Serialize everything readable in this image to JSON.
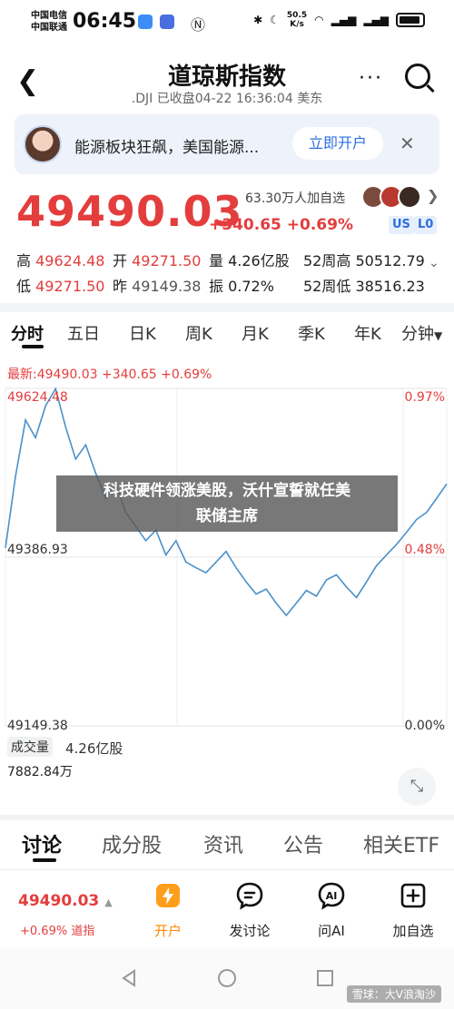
{
  "status_bar": {
    "carrier1": "中国电信",
    "carrier2": "中国联通",
    "time": "06:45",
    "net_speed_value": "50.5",
    "net_speed_unit": "K/s",
    "battery": "100"
  },
  "header": {
    "title": "道琼斯指数",
    "subtitle": ".DJI 已收盘04-22 16:36:04 美东"
  },
  "banner": {
    "text": "能源板块狂飙，美国能源...",
    "button": "立即开户",
    "close": "✕"
  },
  "quote": {
    "price": "49490.03",
    "change": "+340.65 +0.69%",
    "watchers": "63.30万人加自选",
    "tag_us": "US",
    "tag_l0": "L0"
  },
  "stats": {
    "high_label": "高",
    "high": "49624.48",
    "open_label": "开",
    "open": "49271.50",
    "volume_label": "量",
    "volume": "4.26亿股",
    "w52high_label": "52周高",
    "w52high": "50512.79",
    "low_label": "低",
    "low": "49271.50",
    "prev_label": "昨",
    "prev": "49149.38",
    "amp_label": "振",
    "amp": "0.72%",
    "w52low_label": "52周低",
    "w52low": "38516.23"
  },
  "chart_tabs": [
    "分时",
    "五日",
    "日K",
    "周K",
    "月K",
    "季K",
    "年K",
    "分钟"
  ],
  "chart": {
    "latest_label": "最新:49490.03 +340.65 +0.69%",
    "y_top": "49624.48",
    "y_mid": "49386.93",
    "y_bottom": "49149.38",
    "pct_top": "0.97%",
    "pct_mid": "0.48%",
    "pct_bottom": "0.00%",
    "line_color": "#4a90c8"
  },
  "chart_data": {
    "type": "line",
    "title": "",
    "xlabel": "",
    "ylabel": "",
    "ylim": [
      49149.38,
      49624.48
    ],
    "series": [
      {
        "values": [
          49400,
          49500,
          49580,
          49555,
          49600,
          49624,
          49570,
          49525,
          49545,
          49505,
          49470,
          49490,
          49450,
          49430,
          49410,
          49425,
          49390,
          49410,
          49380,
          49372,
          49365,
          49380,
          49395,
          49372,
          49352,
          49335,
          49342,
          49322,
          49305,
          49322,
          49340,
          49332,
          49355,
          49362,
          49345,
          49330,
          49352,
          49375,
          49390,
          49405,
          49422,
          49440,
          49450,
          49470,
          49490
        ]
      }
    ]
  },
  "volume": {
    "label": "成交量",
    "value": "4.26亿股",
    "max": "7882.84万",
    "expand_icon": "expand-icon"
  },
  "overlay": {
    "line1": "科技硬件领涨美股，沃什宣誓就任美",
    "line2": "联储主席"
  },
  "bottom_tabs": [
    "讨论",
    "成分股",
    "资讯",
    "公告",
    "相关ETF"
  ],
  "action_bar": {
    "price": "49490.03",
    "change": "+0.69% 道指",
    "actions": [
      {
        "label": "开户",
        "icon": "lightning-icon"
      },
      {
        "label": "发讨论",
        "icon": "post-icon"
      },
      {
        "label": "问AI",
        "icon": "ai-icon"
      },
      {
        "label": "加自选",
        "icon": "add-watchlist-icon"
      }
    ]
  },
  "watermark": "雪球：大V浪淘沙"
}
